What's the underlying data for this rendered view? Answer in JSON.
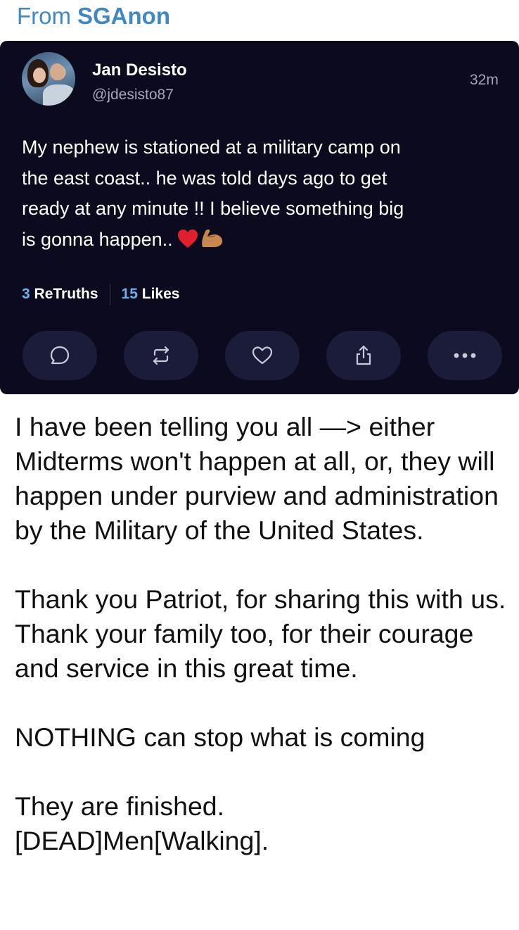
{
  "forward_header": {
    "prefix": "From",
    "channel": "SGAnon"
  },
  "post": {
    "author": {
      "display_name": "Jan Desisto",
      "handle": "@jdesisto87",
      "avatar_icon": "profile-photo"
    },
    "time_ago": "32m",
    "text_lines": [
      "My nephew is stationed at a military camp on",
      "the east coast.. he was told days ago to get",
      "ready at any minute !! I believe something big",
      "is gonna happen.."
    ],
    "emojis": [
      "red-heart-icon",
      "flexed-biceps-icon"
    ],
    "stats": {
      "retruths_count": "3",
      "retruths_label": "ReTruths",
      "likes_count": "15",
      "likes_label": "Likes"
    },
    "actions": [
      {
        "name": "reply-button",
        "icon": "speech-bubble-icon"
      },
      {
        "name": "retruth-button",
        "icon": "repost-arrows-icon"
      },
      {
        "name": "like-button",
        "icon": "heart-icon"
      },
      {
        "name": "share-button",
        "icon": "share-icon"
      },
      {
        "name": "more-button",
        "icon": "more-dots-icon"
      }
    ],
    "colors": {
      "card_background": "#0b0a1e",
      "button_background": "#1b1c3a",
      "stat_number": "#6fb0ef",
      "secondary_text": "#a6a6b8"
    }
  },
  "message": {
    "paragraphs": [
      "I have been telling you all —> either Midterms won't happen at all, or, they will happen under purview and administration by the Military of the United States.",
      "Thank you Patriot, for sharing this with us. Thank your family too, for their courage and service in this great time.",
      "NOTHING can stop what is coming",
      "They are finished. [DEAD]Men[Walking]."
    ]
  },
  "colors": {
    "channel_link": "#3f88c5",
    "message_text": "#111111"
  }
}
